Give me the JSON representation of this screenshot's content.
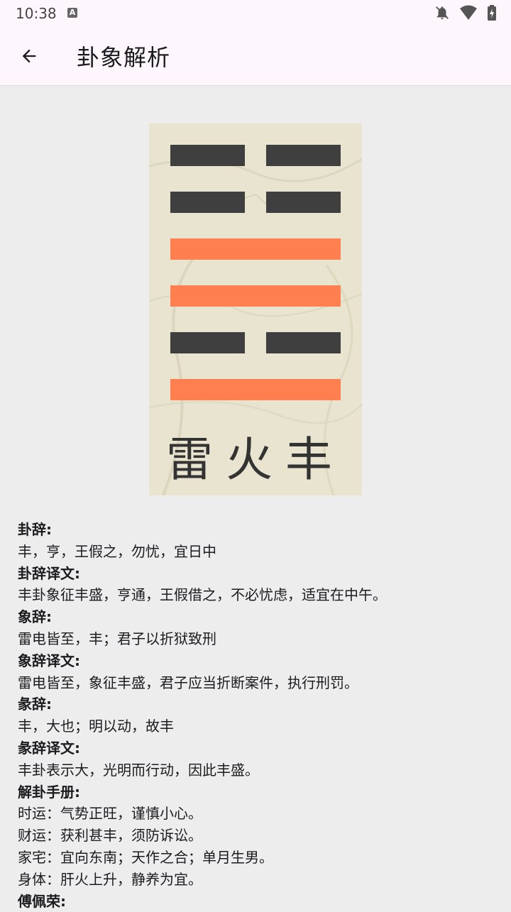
{
  "status_bar": {
    "time": "10:38",
    "notification_letter": "A"
  },
  "app_bar": {
    "title": "卦象解析"
  },
  "hexagram": {
    "name": "雷火丰",
    "lines_top_to_bottom": [
      "yin",
      "yin",
      "yang",
      "yang",
      "yin",
      "yang"
    ],
    "colors": {
      "yang": "#ff7f50",
      "yin": "#3f3f3f"
    }
  },
  "sections": [
    {
      "label": "卦辞:",
      "text": [
        "丰，亨，王假之，勿忧，宜日中"
      ]
    },
    {
      "label": "卦辞译文:",
      "text": [
        "丰卦象征丰盛，亨通，王假借之，不必忧虑，适宜在中午。"
      ]
    },
    {
      "label": "象辞:",
      "text": [
        "雷电皆至，丰；君子以折狱致刑"
      ]
    },
    {
      "label": "象辞译文:",
      "text": [
        "雷电皆至，象征丰盛，君子应当折断案件，执行刑罚。"
      ]
    },
    {
      "label": "彖辞:",
      "text": [
        "丰，大也；明以动，故丰"
      ]
    },
    {
      "label": "彖辞译文:",
      "text": [
        "丰卦表示大，光明而行动，因此丰盛。"
      ]
    },
    {
      "label": "解卦手册:",
      "text": [
        "时运：气势正旺，谨慎小心。",
        "财运：获利甚丰，须防诉讼。",
        "家宅：宜向东南；天作之合；单月生男。",
        "身体：肝火上升，静养为宜。"
      ]
    },
    {
      "label": "傅佩荣:",
      "text": []
    }
  ]
}
